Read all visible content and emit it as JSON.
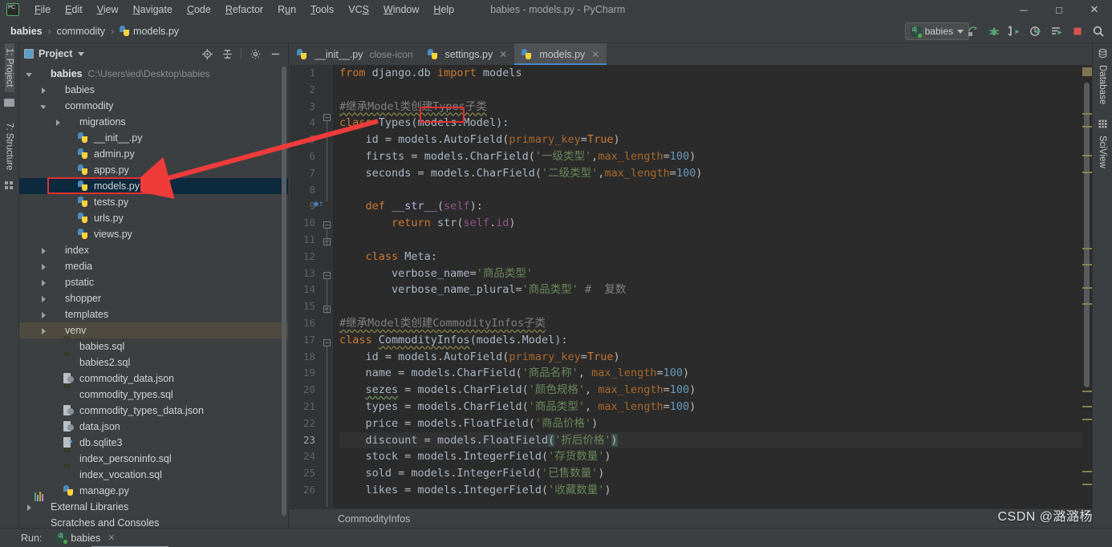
{
  "window": {
    "title": "babies - models.py - PyCharm",
    "logo_icon": "pycharm-logo-icon",
    "minimize_label": "─",
    "maximize_label": "□",
    "close_label": "✕"
  },
  "menu": {
    "items": [
      {
        "label": "File",
        "mnemonic": "F"
      },
      {
        "label": "Edit",
        "mnemonic": "E"
      },
      {
        "label": "View",
        "mnemonic": "V"
      },
      {
        "label": "Navigate",
        "mnemonic": "N"
      },
      {
        "label": "Code",
        "mnemonic": "C"
      },
      {
        "label": "Refactor",
        "mnemonic": "R"
      },
      {
        "label": "Run",
        "mnemonic": "u"
      },
      {
        "label": "Tools",
        "mnemonic": "T"
      },
      {
        "label": "VCS",
        "mnemonic": "S"
      },
      {
        "label": "Window",
        "mnemonic": "W"
      },
      {
        "label": "Help",
        "mnemonic": "H"
      }
    ]
  },
  "breadcrumb": {
    "items": [
      "babies",
      "commodity",
      "models.py"
    ],
    "separator": "›"
  },
  "toolbar": {
    "run_config": "babies",
    "run_config_icon": "django-icon",
    "dropdown_icon": "chevron-down-icon",
    "buttons": [
      {
        "name": "update-project-icon",
        "title": "Update Project"
      },
      {
        "name": "debug-icon",
        "title": "Debug"
      },
      {
        "name": "run-icon",
        "title": "Run"
      },
      {
        "name": "coverage-icon",
        "title": "Run with Coverage"
      },
      {
        "name": "profile-icon",
        "title": "Profile"
      },
      {
        "name": "stop-icon",
        "title": "Stop"
      },
      {
        "name": "search-everywhere-icon",
        "title": "Search Everywhere"
      }
    ]
  },
  "left_strip": {
    "tabs": [
      {
        "label": "1: Project",
        "active": true
      },
      {
        "label": "7: Structure",
        "active": false
      }
    ]
  },
  "right_strip": {
    "tabs": [
      {
        "label": "Database",
        "icon": "database-icon"
      },
      {
        "label": "SciView",
        "icon": "sciview-icon"
      }
    ]
  },
  "project_panel": {
    "title": "Project",
    "view_icon": "project-view-icon",
    "dropdown_icon": "chevron-down-icon",
    "tools": [
      {
        "name": "locate-file-icon"
      },
      {
        "name": "collapse-all-icon"
      },
      {
        "name": "settings-gear-icon"
      },
      {
        "name": "hide-panel-icon"
      }
    ],
    "tree": [
      {
        "label": "babies",
        "path": "C:\\Users\\ied\\Desktop\\babies",
        "icon": "folder-icon",
        "indent": 0,
        "arrow": "open",
        "bold": true
      },
      {
        "label": "babies",
        "icon": "module-icon",
        "indent": 1,
        "arrow": "closed"
      },
      {
        "label": "commodity",
        "icon": "module-icon",
        "indent": 1,
        "arrow": "open"
      },
      {
        "label": "migrations",
        "icon": "module-icon",
        "indent": 2,
        "arrow": "closed"
      },
      {
        "label": "__init__.py",
        "icon": "python-file-icon",
        "indent": 3,
        "arrow": "none"
      },
      {
        "label": "admin.py",
        "icon": "python-file-icon",
        "indent": 3,
        "arrow": "none"
      },
      {
        "label": "apps.py",
        "icon": "python-file-icon",
        "indent": 3,
        "arrow": "none"
      },
      {
        "label": "models.py",
        "icon": "python-file-icon",
        "indent": 3,
        "arrow": "none",
        "selected": true,
        "highlighted": true
      },
      {
        "label": "tests.py",
        "icon": "python-file-icon",
        "indent": 3,
        "arrow": "none"
      },
      {
        "label": "urls.py",
        "icon": "python-file-icon",
        "indent": 3,
        "arrow": "none"
      },
      {
        "label": "views.py",
        "icon": "python-file-icon",
        "indent": 3,
        "arrow": "none"
      },
      {
        "label": "index",
        "icon": "module-icon",
        "indent": 1,
        "arrow": "closed"
      },
      {
        "label": "media",
        "icon": "folder-icon",
        "indent": 1,
        "arrow": "closed"
      },
      {
        "label": "pstatic",
        "icon": "folder-icon",
        "indent": 1,
        "arrow": "closed"
      },
      {
        "label": "shopper",
        "icon": "module-icon",
        "indent": 1,
        "arrow": "closed"
      },
      {
        "label": "templates",
        "icon": "templates-folder-icon",
        "indent": 1,
        "arrow": "closed"
      },
      {
        "label": "venv",
        "icon": "venv-folder-icon",
        "indent": 1,
        "arrow": "closed",
        "hovered": true
      },
      {
        "label": "babies.sql",
        "icon": "sql-file-icon",
        "indent": 2,
        "arrow": "none"
      },
      {
        "label": "babies2.sql",
        "icon": "sql-file-icon",
        "indent": 2,
        "arrow": "none"
      },
      {
        "label": "commodity_data.json",
        "icon": "json-file-icon",
        "indent": 2,
        "arrow": "none"
      },
      {
        "label": "commodity_types.sql",
        "icon": "sql-file-icon",
        "indent": 2,
        "arrow": "none"
      },
      {
        "label": "commodity_types_data.json",
        "icon": "json-file-icon",
        "indent": 2,
        "arrow": "none"
      },
      {
        "label": "data.json",
        "icon": "json-file-icon",
        "indent": 2,
        "arrow": "none"
      },
      {
        "label": "db.sqlite3",
        "icon": "sqlite-file-icon",
        "indent": 2,
        "arrow": "none"
      },
      {
        "label": "index_personinfo.sql",
        "icon": "sql-file-icon",
        "indent": 2,
        "arrow": "none"
      },
      {
        "label": "index_vocation.sql",
        "icon": "sql-file-icon",
        "indent": 2,
        "arrow": "none"
      },
      {
        "label": "manage.py",
        "icon": "python-file-icon",
        "indent": 2,
        "arrow": "none"
      },
      {
        "label": "External Libraries",
        "icon": "libraries-icon",
        "indent": 0,
        "arrow": "closed"
      },
      {
        "label": "Scratches and Consoles",
        "icon": "scratches-icon",
        "indent": 0,
        "arrow": "none"
      }
    ]
  },
  "editor": {
    "tabs": [
      {
        "label": "__init__.py",
        "icon": "python-file-icon",
        "active": false,
        "close_icon": "close-icon"
      },
      {
        "label": "settings.py",
        "icon": "python-file-icon",
        "active": false,
        "close_icon": "close-icon"
      },
      {
        "label": "models.py",
        "icon": "python-file-icon",
        "active": true,
        "close_icon": "close-icon"
      }
    ],
    "bottom_breadcrumb": "CommodityInfos",
    "current_line": 23,
    "lines": [
      {
        "n": 1,
        "text": "from django.db import models"
      },
      {
        "n": 2,
        "text": ""
      },
      {
        "n": 3,
        "text": "#继承Model类创建Types子类"
      },
      {
        "n": 4,
        "text": "class Types(models.Model):"
      },
      {
        "n": 5,
        "text": "    id = models.AutoField(primary_key=True)"
      },
      {
        "n": 6,
        "text": "    firsts = models.CharField('一级类型',max_length=100)"
      },
      {
        "n": 7,
        "text": "    seconds = models.CharField('二级类型',max_length=100)"
      },
      {
        "n": 8,
        "text": ""
      },
      {
        "n": 9,
        "text": "    def __str__(self):"
      },
      {
        "n": 10,
        "text": "        return str(self.id)"
      },
      {
        "n": 11,
        "text": ""
      },
      {
        "n": 12,
        "text": "    class Meta:"
      },
      {
        "n": 13,
        "text": "        verbose_name='商品类型'"
      },
      {
        "n": 14,
        "text": "        verbose_name_plural='商品类型' # 复数"
      },
      {
        "n": 15,
        "text": ""
      },
      {
        "n": 16,
        "text": "#继承Model类创建CommodityInfos子类"
      },
      {
        "n": 17,
        "text": "class CommodityInfos(models.Model):"
      },
      {
        "n": 18,
        "text": "    id = models.AutoField(primary_key=True)"
      },
      {
        "n": 19,
        "text": "    name = models.CharField('商品名称', max_length=100)"
      },
      {
        "n": 20,
        "text": "    sezes = models.CharField('颜色规格', max_length=100)"
      },
      {
        "n": 21,
        "text": "    types = models.CharField('商品类型', max_length=100)"
      },
      {
        "n": 22,
        "text": "    price = models.FloatField('商品价格')"
      },
      {
        "n": 23,
        "text": "    discount = models.FloatField('折后价格')"
      },
      {
        "n": 24,
        "text": "    stock = models.IntegerField('存货数量')"
      },
      {
        "n": 25,
        "text": "    sold = models.IntegerField('已售数量')"
      },
      {
        "n": 26,
        "text": "    likes = models.IntegerField('收藏数量')"
      }
    ]
  },
  "run_panel": {
    "label": "Run:",
    "tab_label": "babies",
    "tab_icon": "django-icon",
    "close_icon": "close-icon"
  },
  "annotation": {
    "arrow_color": "#f03b3b",
    "highlight_color": "#e03030",
    "target_token": "Types"
  },
  "watermark": {
    "text": "CSDN @潞潞杨"
  },
  "colors": {
    "bg_panel": "#3c3f41",
    "bg_editor": "#2b2b2b",
    "gutter": "#313335",
    "selection": "#0d293e",
    "accent_tab": "#4a88c7",
    "keyword": "#cc7832",
    "string": "#6a8759",
    "number": "#6897bb",
    "comment": "#808080",
    "function": "#b5b6e3",
    "kwarg": "#a9682c"
  }
}
